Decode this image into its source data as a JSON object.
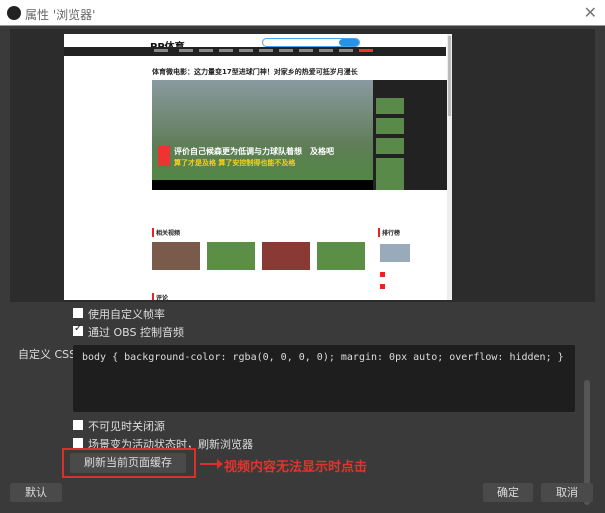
{
  "window": {
    "title": "属性 '浏览器'",
    "close": "✕"
  },
  "webpage": {
    "logo": "PP体育",
    "headline": "体育微电影：这力量变17型进球门神！对家乡的热爱可抵岁月漫长",
    "video_caption_1": "评价自己候森更为低调与力球队着想　及格吧",
    "video_caption_2": "算了才是及格 算了安控制得也能不及格",
    "section_related": "相关视频",
    "section_rank": "排行榜",
    "section_comments": "评论"
  },
  "props": {
    "custom_fps": {
      "label": "使用自定义帧率",
      "checked": false
    },
    "obs_audio": {
      "label": "通过 OBS 控制音频",
      "checked": true
    },
    "css_label": "自定义 CSS",
    "css_value": "body { background-color: rgba(0, 0, 0, 0); margin: 0px auto; overflow: hidden; }",
    "shutdown_hidden": {
      "label": "不可见时关闭源",
      "checked": false
    },
    "refresh_active": {
      "label": "场景变为活动状态时，刷新浏览器",
      "checked": false
    },
    "refresh_cache_button": "刷新当前页面缓存",
    "annotation": "视频内容无法显示时点击"
  },
  "footer": {
    "defaults": "默认",
    "ok": "确定",
    "cancel": "取消"
  },
  "colors": {
    "annotation": "#e0342d",
    "bg": "#3a3a3a"
  }
}
